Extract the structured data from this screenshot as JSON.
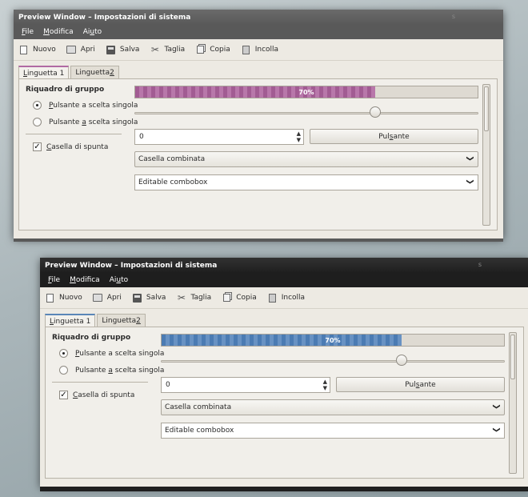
{
  "windows": [
    {
      "title": "Preview Window – Impostazioni di sistema",
      "title_mark": "s",
      "theme": "purple",
      "accent": "#a25c93",
      "menu": [
        {
          "pre": "",
          "u": "F",
          "post": "ile"
        },
        {
          "pre": "",
          "u": "M",
          "post": "odifica"
        },
        {
          "pre": "Ai",
          "u": "u",
          "post": "to"
        }
      ],
      "toolbar": [
        {
          "icon": "new-document-icon",
          "label": "Nuovo"
        },
        {
          "icon": "open-folder-icon",
          "label": "Apri"
        },
        {
          "icon": "save-disk-icon",
          "label": "Salva"
        },
        {
          "icon": "cut-scissors-icon",
          "label": "Taglia"
        },
        {
          "icon": "copy-icon",
          "label": "Copia"
        },
        {
          "icon": "paste-icon",
          "label": "Incolla"
        }
      ],
      "tabs": [
        {
          "pre": "",
          "u": "L",
          "post": "inguetta 1",
          "active": true
        },
        {
          "pre": "Linguetta ",
          "u": "2",
          "post": "",
          "active": false
        }
      ],
      "group_title": "Riquadro di gruppo",
      "radios": [
        {
          "pre": "",
          "u": "P",
          "post": "ulsante a scelta singola",
          "checked": true
        },
        {
          "pre": "Pulsante ",
          "u": "a",
          "post": " scelta singola",
          "checked": false
        }
      ],
      "checkbox": {
        "pre": "",
        "u": "C",
        "post": "asella di spunta",
        "checked": true
      },
      "progress": {
        "value": 0.7,
        "label": "70%"
      },
      "slider": {
        "value": 0.7
      },
      "spin_value": "0",
      "button": {
        "pre": "Pul",
        "u": "s",
        "post": "ante"
      },
      "combo": "Casella combinata",
      "editable_combo": "Editable combobox"
    },
    {
      "title": "Preview Window – Impostazioni di sistema",
      "title_mark": "s",
      "theme": "blue",
      "accent": "#4b7bb3",
      "menu": [
        {
          "pre": "",
          "u": "F",
          "post": "ile"
        },
        {
          "pre": "",
          "u": "M",
          "post": "odifica"
        },
        {
          "pre": "Ai",
          "u": "u",
          "post": "to"
        }
      ],
      "toolbar": [
        {
          "icon": "new-document-icon",
          "label": "Nuovo"
        },
        {
          "icon": "open-folder-icon",
          "label": "Apri"
        },
        {
          "icon": "save-disk-icon",
          "label": "Salva"
        },
        {
          "icon": "cut-scissors-icon",
          "label": "Taglia"
        },
        {
          "icon": "copy-icon",
          "label": "Copia"
        },
        {
          "icon": "paste-icon",
          "label": "Incolla"
        }
      ],
      "tabs": [
        {
          "pre": "",
          "u": "L",
          "post": "inguetta 1",
          "active": true
        },
        {
          "pre": "Linguetta ",
          "u": "2",
          "post": "",
          "active": false
        }
      ],
      "group_title": "Riquadro di gruppo",
      "radios": [
        {
          "pre": "",
          "u": "P",
          "post": "ulsante a scelta singola",
          "checked": true
        },
        {
          "pre": "Pulsante ",
          "u": "a",
          "post": " scelta singola",
          "checked": false
        }
      ],
      "checkbox": {
        "pre": "",
        "u": "C",
        "post": "asella di spunta",
        "checked": true
      },
      "progress": {
        "value": 0.7,
        "label": "70%"
      },
      "slider": {
        "value": 0.7
      },
      "spin_value": "0",
      "button": {
        "pre": "Pul",
        "u": "s",
        "post": "ante"
      },
      "combo": "Casella combinata",
      "editable_combo": "Editable combobox"
    }
  ]
}
